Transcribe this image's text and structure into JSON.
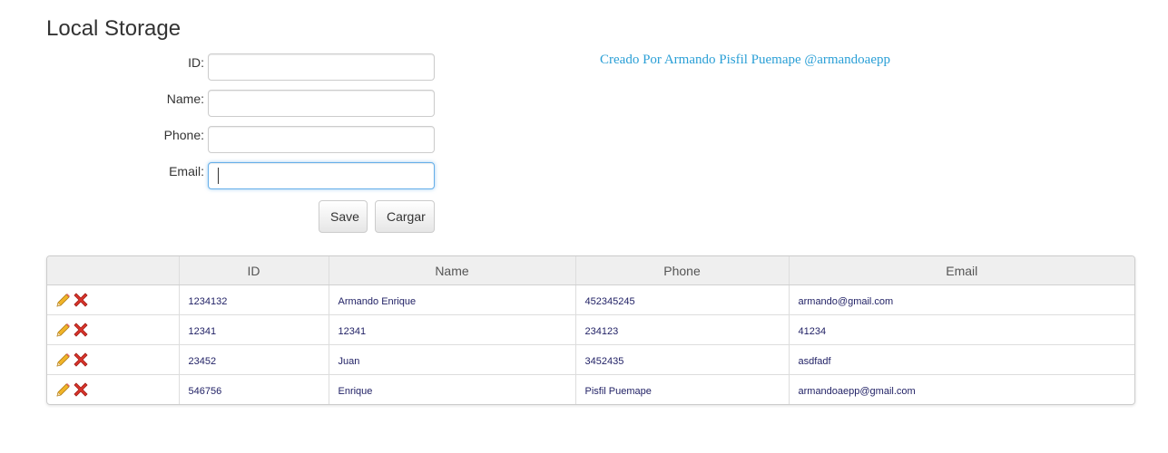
{
  "page": {
    "title": "Local Storage"
  },
  "form": {
    "fields": [
      {
        "label": "ID:",
        "value": "",
        "placeholder": ""
      },
      {
        "label": "Name:",
        "value": "",
        "placeholder": ""
      },
      {
        "label": "Phone:",
        "value": "",
        "placeholder": ""
      },
      {
        "label": "Email:",
        "value": "",
        "placeholder": ""
      }
    ],
    "save_label": "Save",
    "load_label": "Cargar"
  },
  "credit": {
    "text": "Creado Por Armando Pisfil Puemape @armandoaepp",
    "color": "#2a9fd6"
  },
  "table": {
    "headers": [
      "",
      "ID",
      "Name",
      "Phone",
      "Email"
    ],
    "rows": [
      {
        "id": "1234132",
        "name": "Armando Enrique",
        "phone": "452345245",
        "email": "armando@gmail.com"
      },
      {
        "id": "12341",
        "name": "12341",
        "phone": "234123",
        "email": "41234"
      },
      {
        "id": "23452",
        "name": "Juan",
        "phone": "3452435",
        "email": "asdfadf"
      },
      {
        "id": "546756",
        "name": "Enrique",
        "phone": "Pisfil Puemape",
        "email": "armandoaepp@gmail.com"
      }
    ],
    "row_icons": [
      "pencil-icon",
      "delete-x-icon"
    ]
  }
}
